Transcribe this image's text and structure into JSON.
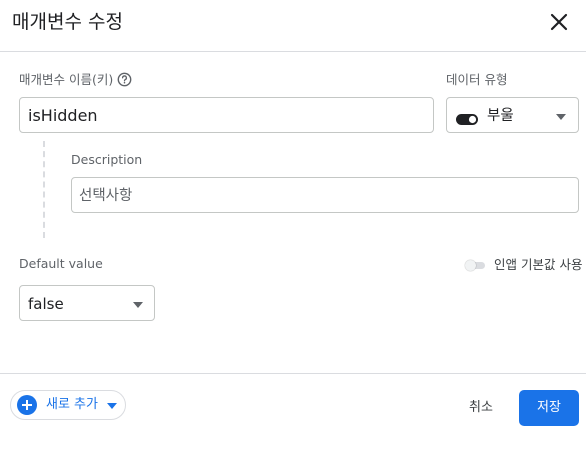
{
  "dialog": {
    "title": "매개변수 수정",
    "close_icon": "close-icon"
  },
  "param_name": {
    "label": "매개변수 이름(키)",
    "help_icon": "help-circle-icon",
    "value": "isHidden"
  },
  "data_type": {
    "label": "데이터 유형",
    "icon": "toggle-icon",
    "value": "부울"
  },
  "description": {
    "label": "Description",
    "placeholder": "선택사항"
  },
  "default_value": {
    "label": "Default value",
    "value": "false"
  },
  "in_app_default": {
    "label": "인앱 기본값 사용",
    "enabled": false
  },
  "footer": {
    "add_new_label": "새로 추가",
    "cancel_label": "취소",
    "save_label": "저장"
  },
  "colors": {
    "accent": "#1a73e8",
    "border": "#c4c7c5",
    "divider": "#dadce0"
  }
}
